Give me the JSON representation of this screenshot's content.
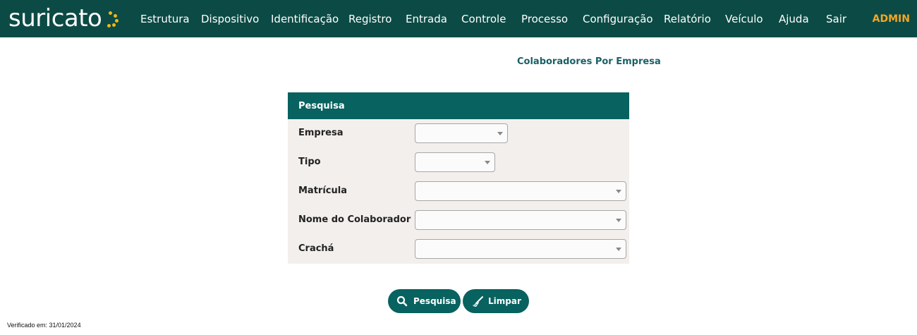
{
  "header": {
    "logo_text": "suricato",
    "brand_color": "#0c4b45",
    "accent_color": "#f2b51d",
    "nav": [
      {
        "label": "Estrutura"
      },
      {
        "label": "Dispositivo"
      },
      {
        "label": "Identificação"
      },
      {
        "label": "Registro"
      },
      {
        "label": "Entrada"
      },
      {
        "label": "Controle"
      },
      {
        "label": "Processo"
      },
      {
        "label": "Configuração"
      },
      {
        "label": "Relatório"
      },
      {
        "label": "Veículo"
      },
      {
        "label": "Ajuda"
      },
      {
        "label": "Sair"
      }
    ],
    "user": "ADMIN"
  },
  "page": {
    "title": "Colaboradores Por Empresa"
  },
  "search_panel": {
    "header": "Pesquisa",
    "fields": [
      {
        "label": "Empresa",
        "value": ""
      },
      {
        "label": "Tipo",
        "value": ""
      },
      {
        "label": "Matrícula",
        "value": ""
      },
      {
        "label": "Nome do Colaborador",
        "value": ""
      },
      {
        "label": "Crachá",
        "value": ""
      }
    ]
  },
  "actions": {
    "search_label": "Pesquisa",
    "search_icon": "search-icon",
    "clear_label": "Limpar",
    "clear_icon": "broom-icon"
  },
  "footer": {
    "verified": "Verificado em: 31/01/2024"
  }
}
